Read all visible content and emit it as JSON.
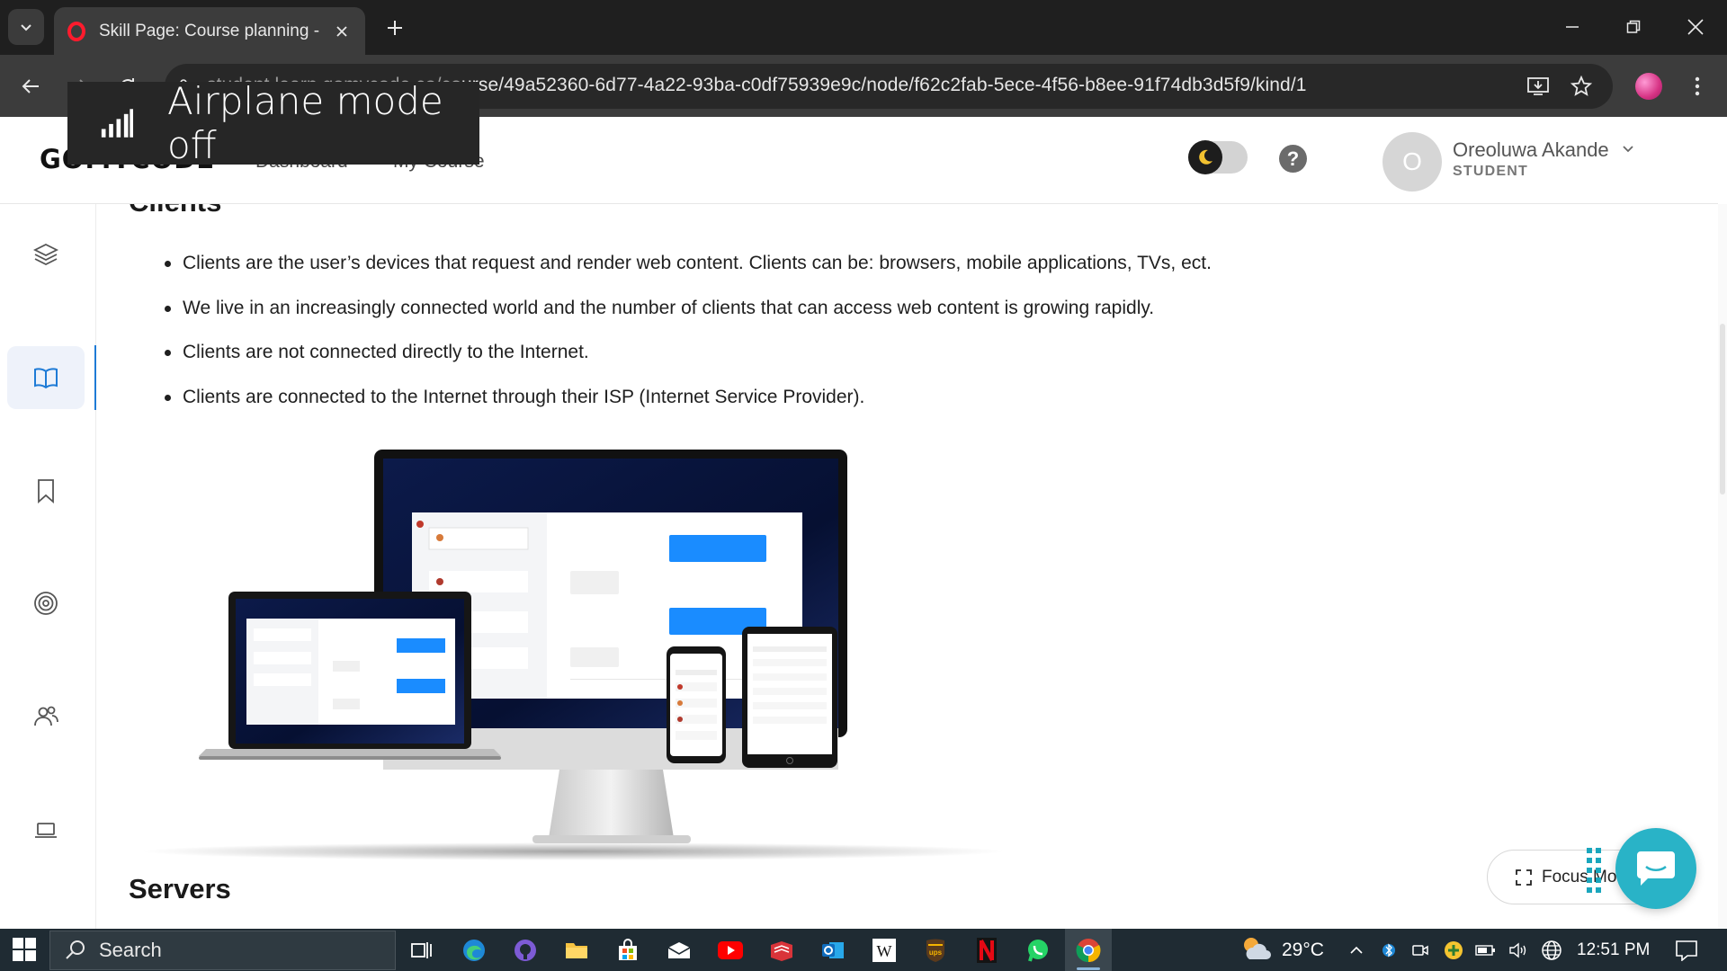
{
  "browser": {
    "tab_title": "Skill Page: Course planning - G(",
    "url_domain": "student.learn.gomycode.co/co",
    "url_path": "urse/49a52360-6d77-4a22-93ba-c0df75939e9c/node/f62c2fab-5ece-4f56-b8ee-91f74db3d5f9/kind/1"
  },
  "toast": {
    "text": "Airplane mode off"
  },
  "header": {
    "logo": "GOMYCODE",
    "nav": [
      "Dashboard",
      "My Course"
    ],
    "help_label": "?",
    "user": {
      "initial": "O",
      "name": "Oreoluwa Akande",
      "role": "STUDENT"
    }
  },
  "content": {
    "section_heading_cut": "Clients",
    "bullets": [
      "Clients are the user’s devices that request and render web content. Clients can be: browsers, mobile applications, TVs, ect.",
      "We live in an increasingly connected world and the number of clients that can access web content is growing rapidly.",
      "Clients are not connected directly to the Internet.",
      "Clients are connected to the Internet through their ISP (Internet Service Provider)."
    ],
    "next_heading": "Servers"
  },
  "focus_mode": {
    "label": "Focus Mo"
  },
  "taskbar": {
    "search_label": "Search",
    "temperature": "29°C",
    "time": "12:51 PM"
  },
  "colors": {
    "accent": "#1e7bd6",
    "chat_fab": "#29b3c7",
    "taskbar": "#1f2b33"
  }
}
